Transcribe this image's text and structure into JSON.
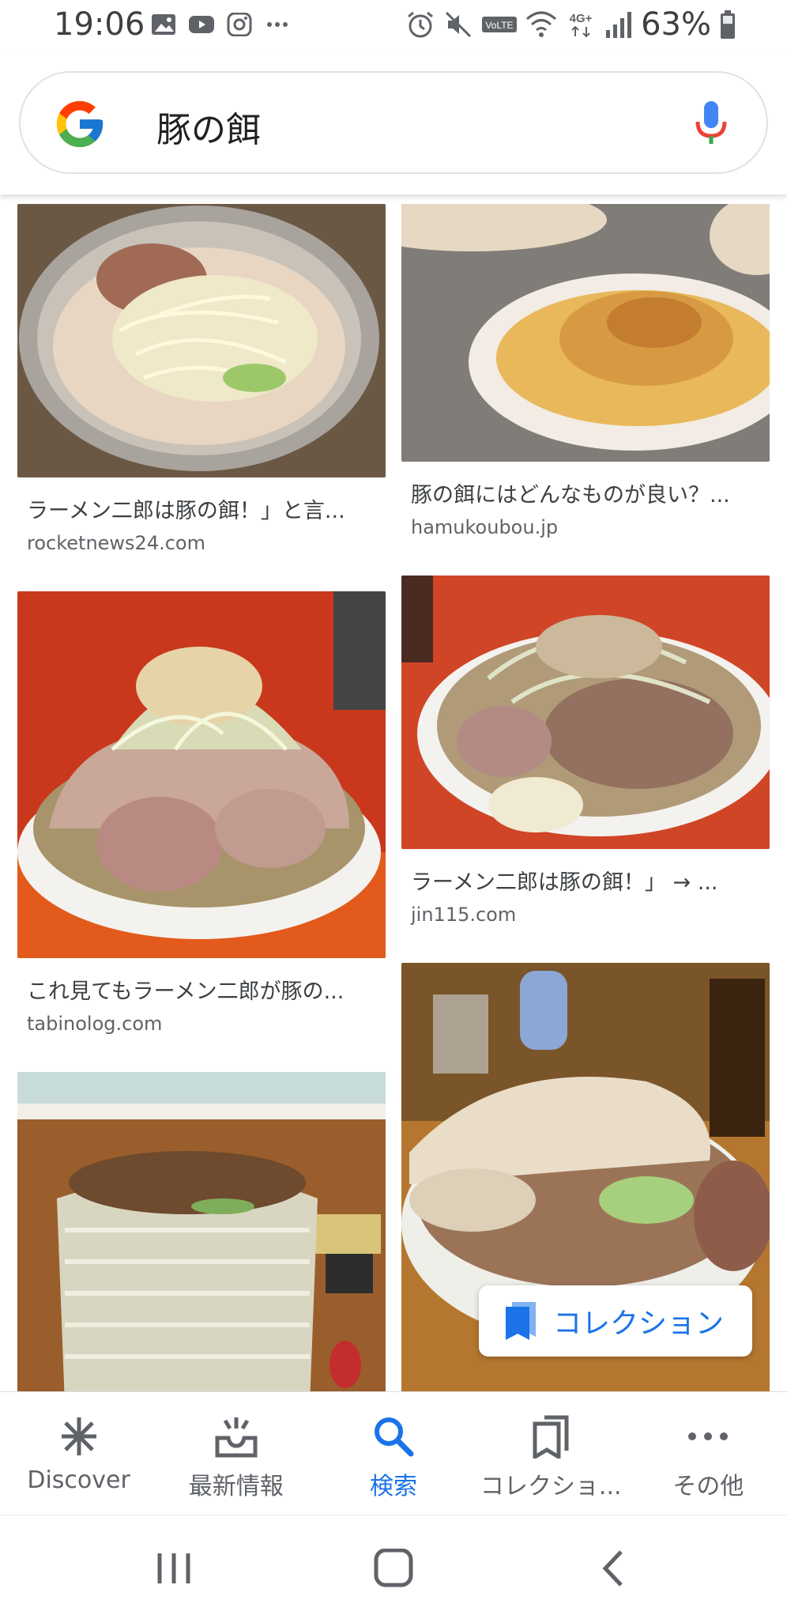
{
  "status_bar": {
    "time": "19:06",
    "left_icons": [
      "gallery-icon",
      "youtube-icon",
      "instagram-icon",
      "more-dots-icon"
    ],
    "right_icons": [
      "alarm-icon",
      "mute-icon",
      "volte-icon",
      "wifi-icon",
      "4g-icon",
      "signal-icon"
    ],
    "volte": "VoLTE",
    "network": "4G+",
    "battery": "63%"
  },
  "search": {
    "query": "豚の餌",
    "logo": "google-logo",
    "mic_icon": "mic-icon"
  },
  "results": [
    {
      "title": "ラーメン二郎は豚の餌！」と言...",
      "source": "rocketnews24.com"
    },
    {
      "title": "豚の餌にはどんなものが良い？...",
      "source": "hamukoubou.jp"
    },
    {
      "title": "これ見てもラーメン二郎が豚の...",
      "source": "tabinolog.com"
    },
    {
      "title": "ラーメン二郎は豚の餌！」 → ...",
      "source": "jin115.com"
    },
    {
      "title": "",
      "source": ""
    },
    {
      "title": "",
      "source": ""
    }
  ],
  "collection_chip": {
    "label": "コレクション",
    "icon": "bookmark-icon"
  },
  "bottom_nav": [
    {
      "label": "Discover",
      "icon": "asterisk-icon",
      "active": false
    },
    {
      "label": "最新情報",
      "icon": "inbox-update-icon",
      "active": false
    },
    {
      "label": "検索",
      "icon": "search-icon",
      "active": true
    },
    {
      "label": "コレクショ...",
      "icon": "collections-icon",
      "active": false
    },
    {
      "label": "その他",
      "icon": "more-icon",
      "active": false
    }
  ],
  "colors": {
    "accent": "#1a73e8",
    "text": "#202124",
    "muted": "#5f6368"
  }
}
